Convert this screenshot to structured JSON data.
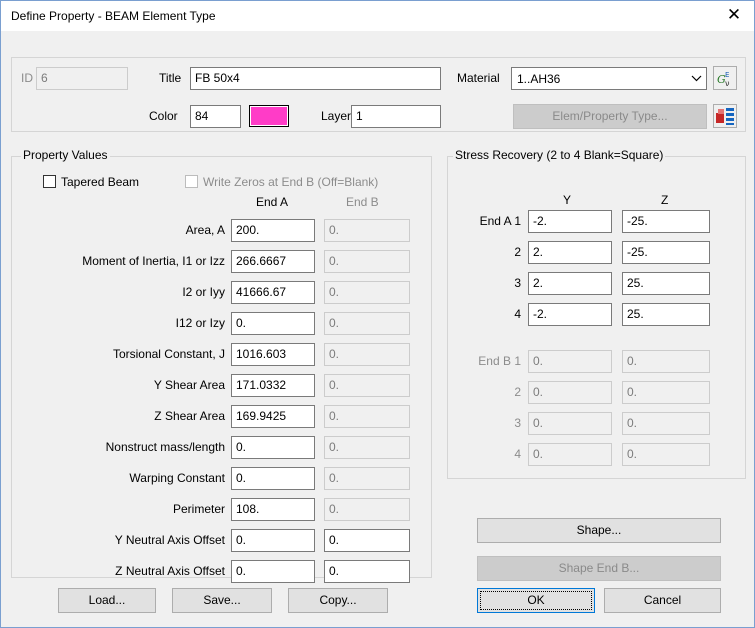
{
  "window": {
    "title": "Define Property - BEAM Element Type",
    "close_glyph": "✕"
  },
  "header": {
    "id_label": "ID",
    "id_value": "6",
    "title_label": "Title",
    "title_value": "FB 50x4",
    "material_label": "Material",
    "material_value": "1..AH36",
    "color_label": "Color",
    "color_value": "84",
    "color_swatch": "#ff3cc7",
    "layer_label": "Layer",
    "layer_value": "1",
    "elem_type_button": "Elem/Property Type...",
    "material_icon": "function-material-icon",
    "elem_type_icon": "element-type-icon"
  },
  "property_values": {
    "group_label": "Property Values",
    "tapered_label": "Tapered Beam",
    "write_zeros_label": "Write Zeros at End B (Off=Blank)",
    "end_a_header": "End A",
    "end_b_header": "End B",
    "rows": [
      {
        "label": "Area, A",
        "end_a": "200.",
        "end_b": "0."
      },
      {
        "label": "Moment of Inertia, I1 or Izz",
        "end_a": "266.6667",
        "end_b": "0."
      },
      {
        "label": "I2 or Iyy",
        "end_a": "41666.67",
        "end_b": "0."
      },
      {
        "label": "I12 or Izy",
        "end_a": "0.",
        "end_b": "0."
      },
      {
        "label": "Torsional Constant, J",
        "end_a": "1016.603",
        "end_b": "0."
      },
      {
        "label": "Y Shear Area",
        "end_a": "171.0332",
        "end_b": "0."
      },
      {
        "label": "Z Shear Area",
        "end_a": "169.9425",
        "end_b": "0."
      },
      {
        "label": "Nonstruct mass/length",
        "end_a": "0.",
        "end_b": "0."
      },
      {
        "label": "Warping Constant",
        "end_a": "0.",
        "end_b": "0."
      },
      {
        "label": "Perimeter",
        "end_a": "108.",
        "end_b": "0."
      },
      {
        "label": "Y Neutral Axis Offset",
        "end_a": "0.",
        "end_b": "0."
      },
      {
        "label": "Z Neutral Axis Offset",
        "end_a": "0.",
        "end_b": "0."
      }
    ]
  },
  "stress_recovery": {
    "group_label": "Stress Recovery (2 to 4 Blank=Square)",
    "y_header": "Y",
    "z_header": "Z",
    "end_a": [
      {
        "label": "End A 1",
        "y": "-2.",
        "z": "-25."
      },
      {
        "label": "2",
        "y": "2.",
        "z": "-25."
      },
      {
        "label": "3",
        "y": "2.",
        "z": "25."
      },
      {
        "label": "4",
        "y": "-2.",
        "z": "25."
      }
    ],
    "end_b": [
      {
        "label": "End B 1",
        "y": "0.",
        "z": "0."
      },
      {
        "label": "2",
        "y": "0.",
        "z": "0."
      },
      {
        "label": "3",
        "y": "0.",
        "z": "0."
      },
      {
        "label": "4",
        "y": "0.",
        "z": "0."
      }
    ]
  },
  "buttons": {
    "shape": "Shape...",
    "shape_end_b": "Shape End B...",
    "load": "Load...",
    "save": "Save...",
    "copy": "Copy...",
    "ok": "OK",
    "cancel": "Cancel"
  }
}
